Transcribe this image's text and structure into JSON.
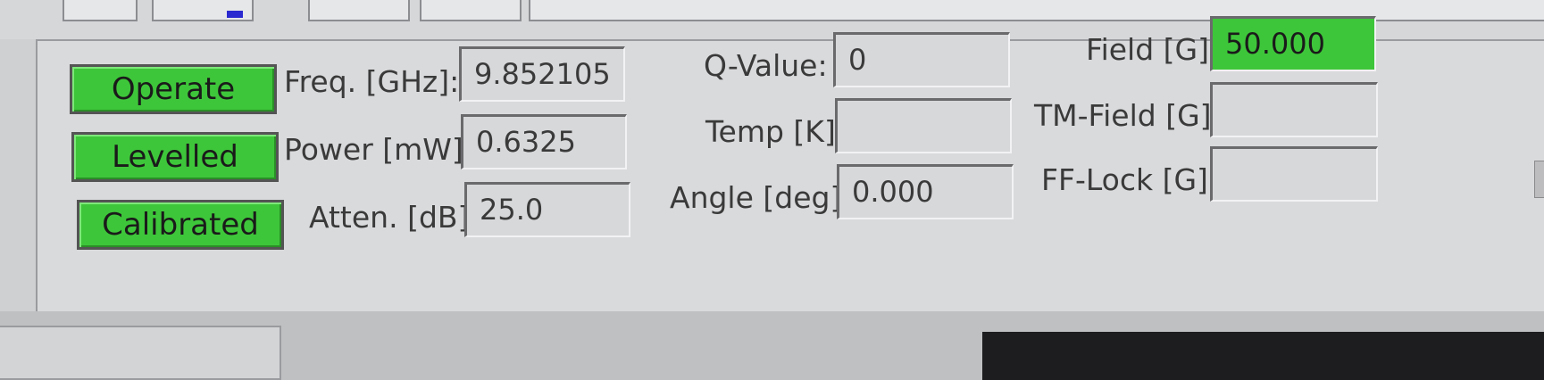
{
  "status_buttons": {
    "operate": "Operate",
    "levelled": "Levelled",
    "calibrated": "Calibrated"
  },
  "col1": {
    "freq_label": "Freq. [GHz]:",
    "freq_value": "9.852105",
    "power_label": "Power [mW]:",
    "power_value": "0.6325",
    "atten_label": "Atten. [dB]:",
    "atten_value": "25.0"
  },
  "col2": {
    "q_label": "Q-Value:",
    "q_value": "0",
    "temp_label": "Temp [K]:",
    "temp_value": "",
    "angle_label": "Angle [deg]:",
    "angle_value": "0.000"
  },
  "col3": {
    "field_label": "Field [G]:",
    "field_value": "50.000",
    "tm_label": "TM-Field [G]:",
    "tm_value": "",
    "ff_label": "FF-Lock [G]:",
    "ff_value": ""
  },
  "colors": {
    "status_green": "#3ec63a",
    "panel_gray": "#d9dadc"
  }
}
